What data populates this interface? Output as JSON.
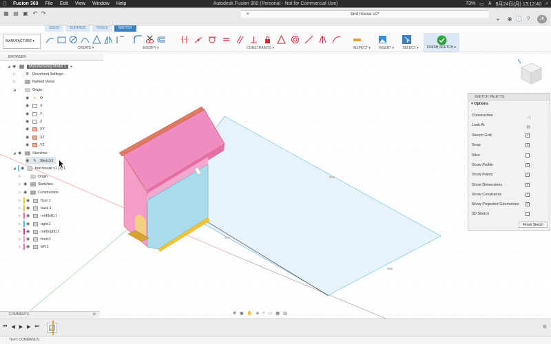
{
  "menubar": {
    "app_name": "Fusion 360",
    "items": [
      "File",
      "Edit",
      "View",
      "Window",
      "Help"
    ],
    "window_title": "Autodesk Fusion 360 (Personal - Not for Commercial Use)",
    "battery": "73%",
    "input_mode": "A",
    "datetime": "8月24日(月)  13:12:40",
    "user_initials": "JK"
  },
  "document": {
    "tab_title": "bird house v2*"
  },
  "workspace": {
    "selector_label": "MANUFACTURE ▾",
    "tabs": [
      "SOLID",
      "SURFACE",
      "TOOLS",
      "SKETCH"
    ],
    "active_tab": "SKETCH"
  },
  "toolbar": {
    "groups": {
      "create": "CREATE ▾",
      "modify": "MODIFY ▾",
      "constraints": "CONSTRAINTS ▾",
      "inspect": "INSPECT ▾",
      "insert": "INSERT ▾",
      "select": "SELECT ▾",
      "finish": "FINISH SKETCH ▾"
    }
  },
  "browser": {
    "header": "BROWSER",
    "root": "Manufacturing Model 1",
    "document_settings": "Document Settings",
    "named_views": "Named Views",
    "origin": "Origin",
    "origin_items": [
      "O",
      "X",
      "Y",
      "Z",
      "XY",
      "XZ",
      "YZ"
    ],
    "sketches": "Sketches",
    "sketch_item": "Sketch3",
    "component": "bird house v1 (1):1",
    "component_origin": "Origin",
    "component_sketches": "Sketches",
    "component_construction": "Construction",
    "bodies": [
      {
        "name": "floor:1",
        "color": "#f2c230"
      },
      {
        "name": "back:1",
        "color": "#f2c230"
      },
      {
        "name": "roof(left):1",
        "color": "#ef6f9e"
      },
      {
        "name": "right:1",
        "color": "#3bbfe6"
      },
      {
        "name": "roof(right):1",
        "color": "#d23a8f"
      },
      {
        "name": "front:1",
        "color": "#f49bc9"
      },
      {
        "name": "left:1",
        "color": "#ef6fb4"
      }
    ]
  },
  "sketch_palette": {
    "header": "SKETCH PALETTE",
    "options_label": "Options",
    "rows": [
      {
        "label": "Construction",
        "control": "icon"
      },
      {
        "label": "Look At",
        "control": "icon"
      },
      {
        "label": "Sketch Grid",
        "control": "checkbox",
        "checked": true
      },
      {
        "label": "Snap",
        "control": "checkbox",
        "checked": true
      },
      {
        "label": "Slice",
        "control": "checkbox",
        "checked": false
      },
      {
        "label": "Show Profile",
        "control": "checkbox",
        "checked": true
      },
      {
        "label": "Show Points",
        "control": "checkbox",
        "checked": true
      },
      {
        "label": "Show Dimensions",
        "control": "checkbox",
        "checked": true
      },
      {
        "label": "Show Constraints",
        "control": "checkbox",
        "checked": true
      },
      {
        "label": "Show Projected Geometries",
        "control": "checkbox",
        "checked": true
      },
      {
        "label": "3D Sketch",
        "control": "checkbox",
        "checked": false
      }
    ],
    "finish_button": "Finish Sketch"
  },
  "panels": {
    "comments": "COMMENTS",
    "text_commands": "TEXT COMMANDS"
  },
  "colors": {
    "accent": "#3a7fc0",
    "sketch_plane": "#e6f3fb",
    "roof": "#e07a5f",
    "walls": "#f2a0c8",
    "side": "#a8dcec"
  }
}
